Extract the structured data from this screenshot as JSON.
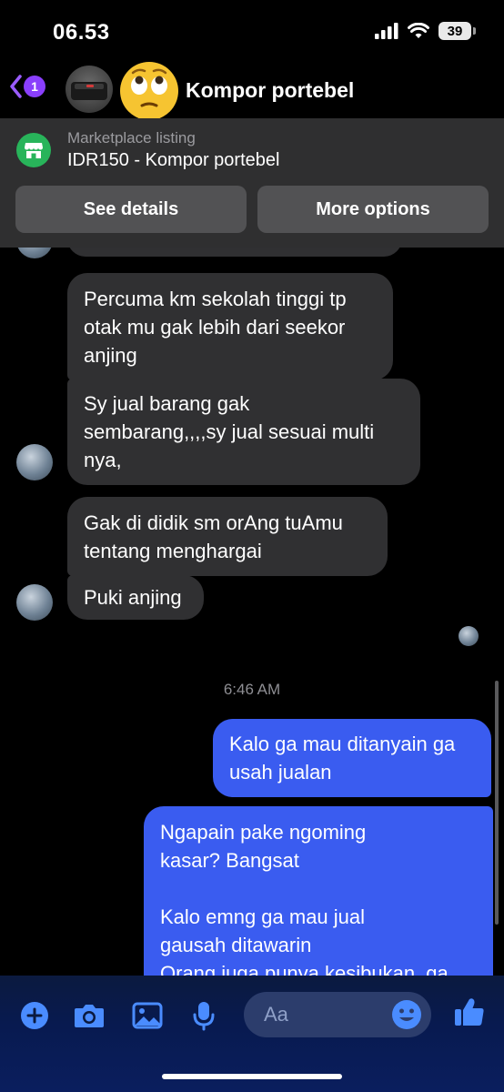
{
  "status_bar": {
    "time": "06.53",
    "battery": "39"
  },
  "header": {
    "back_badge": "1",
    "contact_name": "Kompor portebel"
  },
  "listing": {
    "caption": "Marketplace listing",
    "title": "IDR150 - Kompor portebel",
    "buttons": {
      "details": "See details",
      "options": "More options"
    }
  },
  "messages": {
    "incoming": [
      {
        "lines": [
          "Percuma km sekolah tinggi tp",
          "otak mu gak lebih dari seekor",
          "anjing"
        ]
      },
      {
        "lines": [
          "Sy jual barang gak",
          "sembarang,,,,sy jual sesuai multi",
          "nya,"
        ]
      },
      {
        "lines": [
          "Gak di didik sm orAng tuAmu",
          "tentang menghargai"
        ]
      },
      {
        "lines": [
          "Puki anjing"
        ]
      }
    ],
    "timestamp": "6:46 AM",
    "outgoing": [
      {
        "lines": [
          "Kalo ga mau ditanyain ga",
          "usah jualan"
        ]
      },
      {
        "lines": [
          "Ngapain pake ngoming",
          "kasar? Bangsat",
          "",
          "Kalo emng ga mau jual",
          "gausah ditawarin",
          "Orang juga punya kesibukan, ga"
        ]
      }
    ]
  },
  "composer": {
    "placeholder": "Aa"
  },
  "colors": {
    "outgoing_bubble": "#3a5cf0",
    "incoming_bubble": "#303032",
    "accent": "#8a3ffc",
    "composer_icon": "#4a8cff"
  }
}
